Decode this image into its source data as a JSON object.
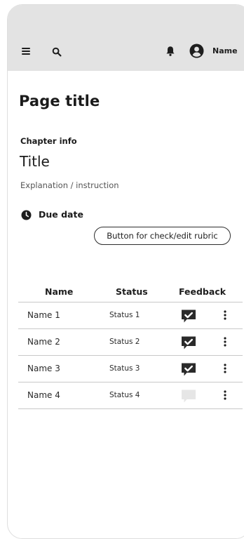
{
  "appbar": {
    "menu_icon": "menu-icon",
    "search_icon": "search-icon",
    "notification_icon": "bell-icon",
    "avatar_icon": "account-circle-icon",
    "user_name": "Name",
    "background": "#e3e3e3"
  },
  "page": {
    "title": "Page title",
    "chapter_label": "Chapter info",
    "assignment_title": "Title",
    "explanation": "Explanation / instruction",
    "due_icon": "clock-icon",
    "due_label": "Due date",
    "rubric_button_label": "Button for check/edit rubric"
  },
  "table": {
    "headers": {
      "name": "Name",
      "status": "Status",
      "feedback": "Feedback"
    },
    "rows": [
      {
        "name": "Name 1",
        "status": "Status 1",
        "feedback_icon": "feedback-given-icon",
        "feedback_given": true
      },
      {
        "name": "Name 2",
        "status": "Status 2",
        "feedback_icon": "feedback-given-icon",
        "feedback_given": true
      },
      {
        "name": "Name 3",
        "status": "Status 3",
        "feedback_icon": "feedback-given-icon",
        "feedback_given": true
      },
      {
        "name": "Name 4",
        "status": "Status 4",
        "feedback_icon": "feedback-empty-icon",
        "feedback_given": false
      }
    ],
    "more_icon": "more-vert-icon"
  },
  "colors": {
    "feedback_given": "#2a2a2a",
    "feedback_empty": "#e6e6e6",
    "divider": "#c8c8c8",
    "text": "#1b1b1b"
  }
}
